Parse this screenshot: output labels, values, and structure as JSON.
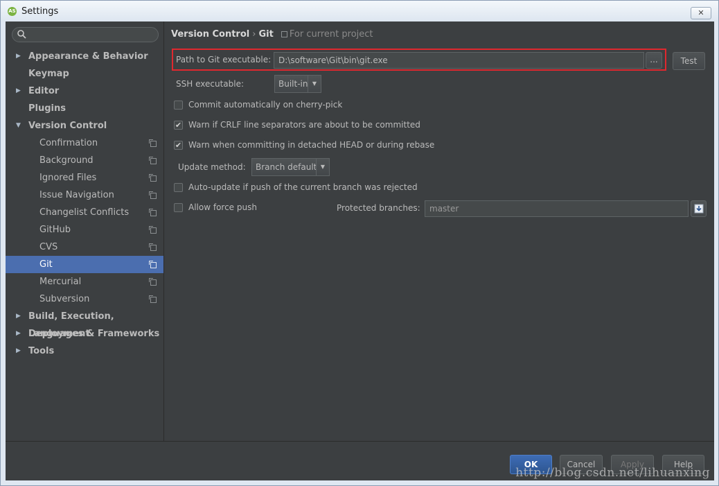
{
  "window": {
    "title": "Settings",
    "close_glyph": "✕"
  },
  "search": {
    "placeholder": ""
  },
  "sidebar": {
    "items": [
      {
        "label": "Appearance & Behavior",
        "level": 0,
        "arrow": "▶"
      },
      {
        "label": "Keymap",
        "level": 0,
        "arrow": ""
      },
      {
        "label": "Editor",
        "level": 0,
        "arrow": "▶"
      },
      {
        "label": "Plugins",
        "level": 0,
        "arrow": ""
      },
      {
        "label": "Version Control",
        "level": 0,
        "arrow": "▼"
      },
      {
        "label": "Confirmation",
        "level": 1
      },
      {
        "label": "Background",
        "level": 1
      },
      {
        "label": "Ignored Files",
        "level": 1
      },
      {
        "label": "Issue Navigation",
        "level": 1
      },
      {
        "label": "Changelist Conflicts",
        "level": 1
      },
      {
        "label": "GitHub",
        "level": 1
      },
      {
        "label": "CVS",
        "level": 1
      },
      {
        "label": "Git",
        "level": 1,
        "selected": true
      },
      {
        "label": "Mercurial",
        "level": 1
      },
      {
        "label": "Subversion",
        "level": 1
      },
      {
        "label": "Build, Execution, Deployment",
        "level": 0,
        "arrow": "▶"
      },
      {
        "label": "Languages & Frameworks",
        "level": 0,
        "arrow": "▶"
      },
      {
        "label": "Tools",
        "level": 0,
        "arrow": "▶"
      }
    ]
  },
  "breadcrumb": {
    "parent": "Version Control",
    "separator": "›",
    "current": "Git",
    "scope": "For current project"
  },
  "git_path": {
    "label": "Path to Git executable:",
    "value": "D:\\software\\Git\\bin\\git.exe",
    "browse": "...",
    "test": "Test"
  },
  "ssh": {
    "label": "SSH executable:",
    "value": "Built-in",
    "drop": "▼"
  },
  "options": {
    "cherry_pick": {
      "label": "Commit automatically on cherry-pick",
      "checked": false
    },
    "crlf": {
      "label": "Warn if CRLF line separators are about to be committed",
      "checked": true
    },
    "detached": {
      "label": "Warn when committing in detached HEAD or during rebase",
      "checked": true
    },
    "auto_update": {
      "label": "Auto-update if push of the current branch was rejected",
      "checked": false
    },
    "force_push": {
      "label": "Allow force push",
      "checked": false
    }
  },
  "update_method": {
    "label": "Update method:",
    "value": "Branch default",
    "drop": "▼"
  },
  "protected": {
    "label": "Protected branches:",
    "value": "master"
  },
  "buttons": {
    "ok": "OK",
    "cancel": "Cancel",
    "apply": "Apply",
    "help": "Help"
  },
  "watermark": "http://blog.csdn.net/lihuanxing",
  "colors": {
    "accent": "#4b6eaf",
    "highlight_border": "#e0282e",
    "bg": "#3c3f41"
  }
}
